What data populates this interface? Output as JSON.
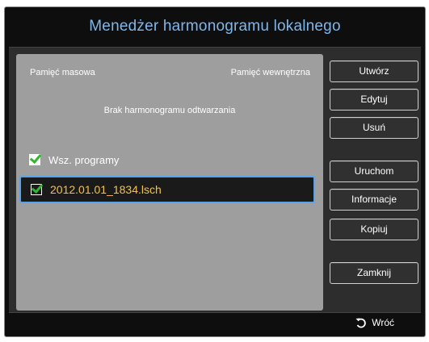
{
  "window": {
    "title": "Menedżer harmonogramu lokalnego"
  },
  "storage": {
    "left": "Pamięć masowa",
    "right": "Pamięć wewnętrzna"
  },
  "list": {
    "empty_message": "Brak harmonogramu odtwarzania",
    "all_programs_label": "Wsz. programy",
    "all_programs_checked": true,
    "file_label": "2012.01.01_1834.lsch",
    "file_checked": true
  },
  "buttons": {
    "create": "Utwórz",
    "edit": "Edytuj",
    "delete": "Usuń",
    "run": "Uruchom",
    "info": "Informacje",
    "copy": "Kopiuj",
    "close": "Zamknij"
  },
  "footer": {
    "back_label": "Wróć",
    "back_icon": "return-icon"
  },
  "colors": {
    "title": "#7fb6e9",
    "selection_border": "#5aa3e6",
    "selected_text": "#f5c342",
    "checkmark": "#2fb82f"
  }
}
